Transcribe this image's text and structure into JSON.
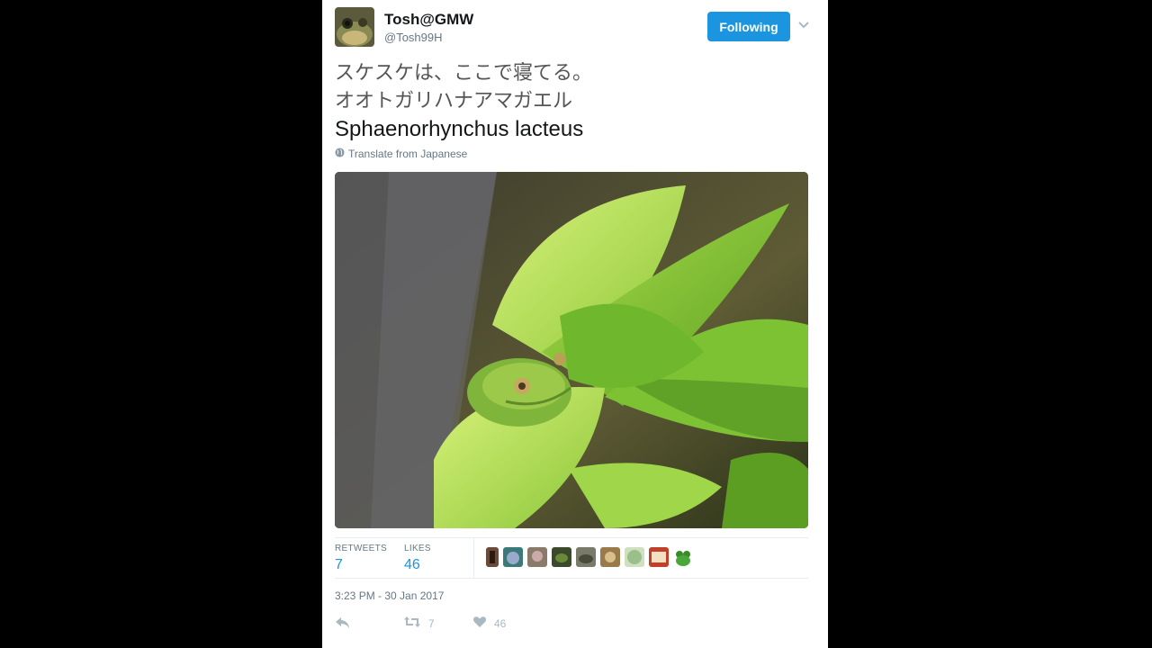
{
  "tweet": {
    "display_name": "Tosh@GMW",
    "screen_name": "@Tosh99H",
    "follow_label": "Following",
    "text_lines": [
      "スケスケは、ここで寝てる。",
      "オオトガリハナアマガエル",
      "Sphaenorhynchus lacteus"
    ],
    "translate_label": "Translate from Japanese",
    "stats": {
      "retweets_label": "RETWEETS",
      "retweets_value": "7",
      "likes_label": "LIKES",
      "likes_value": "46"
    },
    "timestamp": "3:23 PM - 30 Jan 2017",
    "actions": {
      "retweet_count": "7",
      "like_count": "46"
    }
  },
  "colors": {
    "accent": "#1b95e0",
    "secondary_text": "#657786",
    "action_icon": "#aab8c2"
  },
  "icons": [
    "avatar",
    "caret-down-icon",
    "globe-icon",
    "reply-icon",
    "retweet-icon",
    "heart-icon"
  ]
}
